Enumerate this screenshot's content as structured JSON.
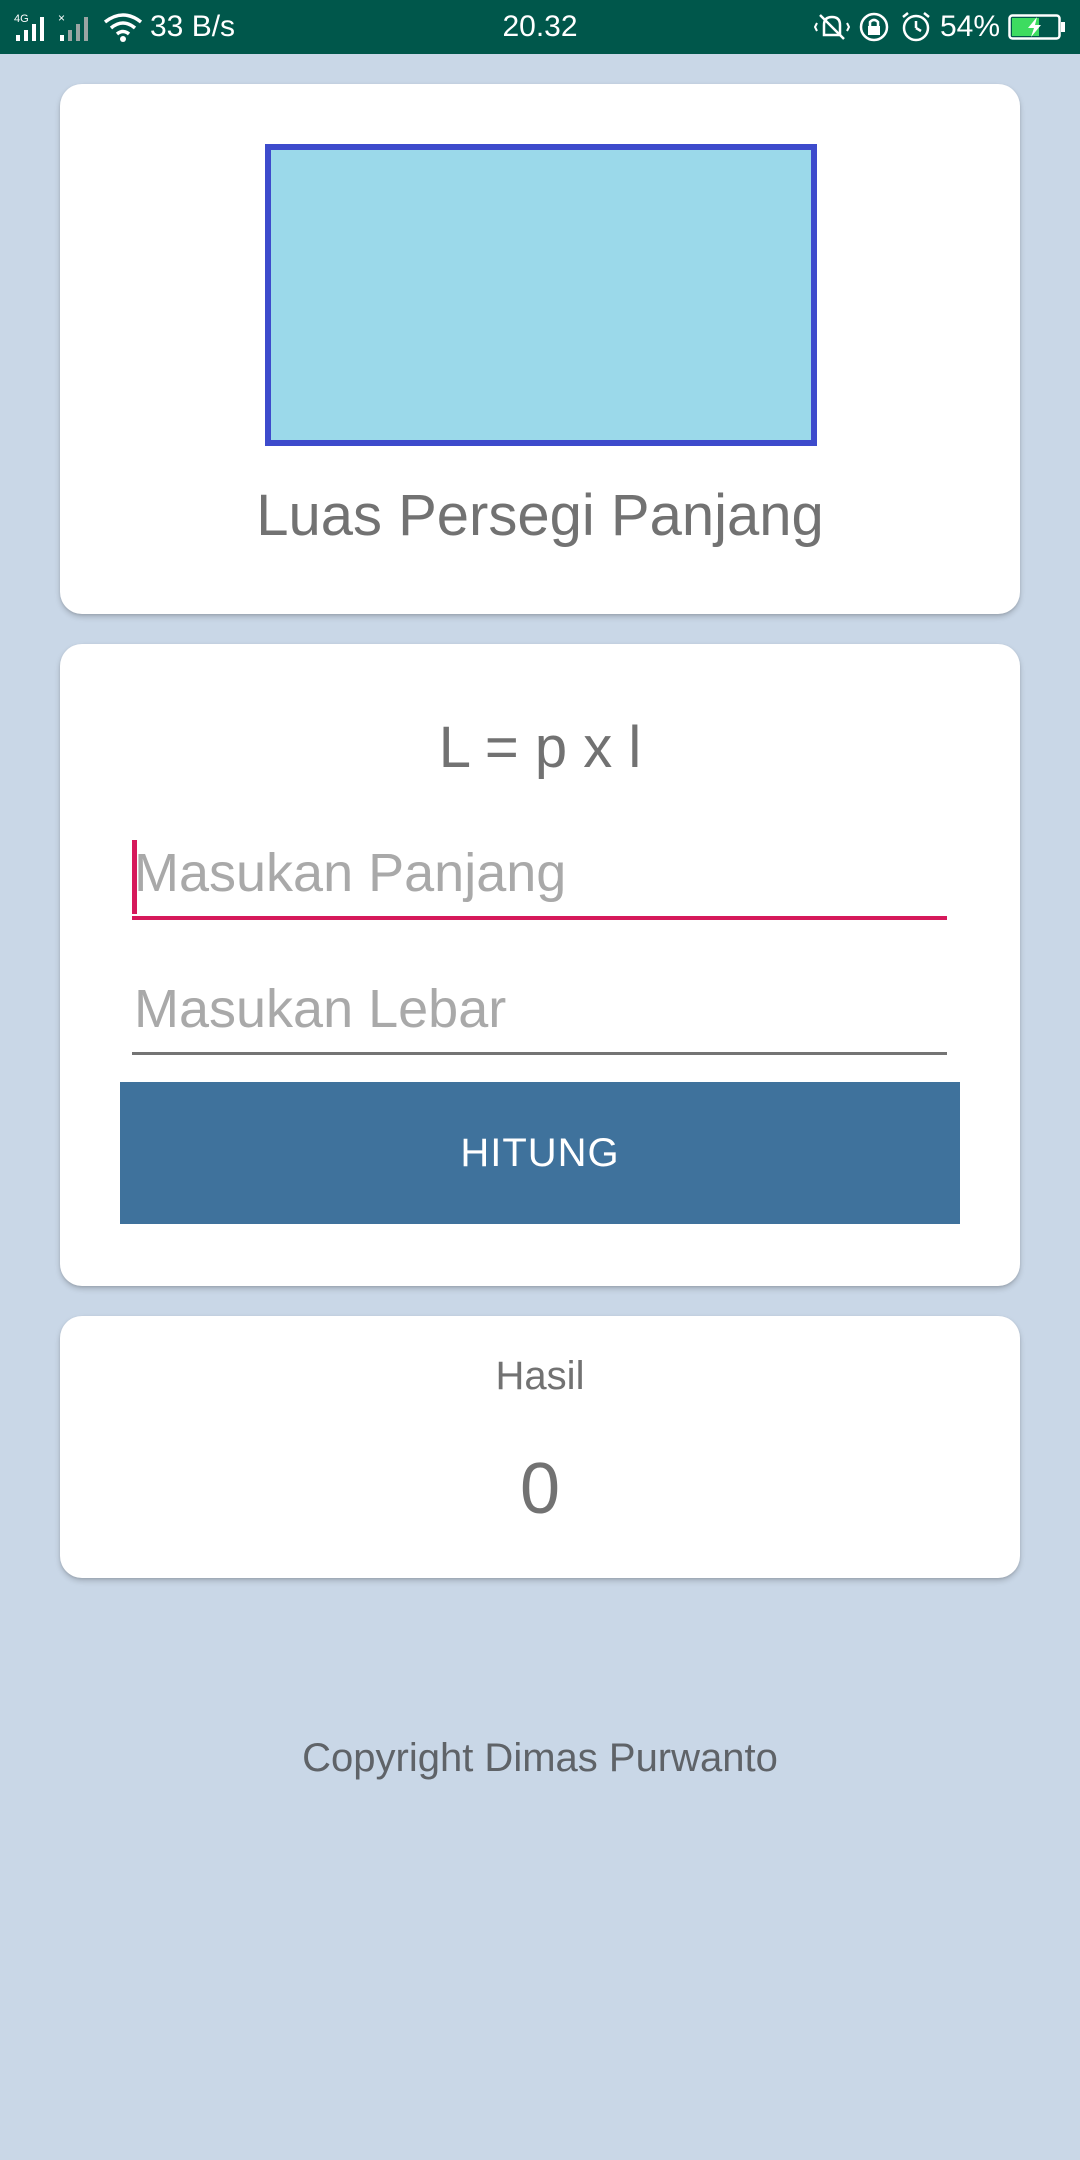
{
  "status_bar": {
    "network_type": "4G",
    "speed": "33 B/s",
    "time": "20.32",
    "battery": "54%",
    "icons": [
      "signal-icon",
      "no-signal-icon",
      "wifi-icon",
      "vibrate-icon",
      "rotation-lock-icon",
      "alarm-icon",
      "battery-charging-icon"
    ]
  },
  "shape_card": {
    "title": "Luas Persegi Panjang",
    "rect_fill": "#9bd9ea",
    "rect_border": "#3d4bcc"
  },
  "form_card": {
    "formula": "L = p x l",
    "panjang_placeholder": "Masukan Panjang",
    "panjang_value": "",
    "lebar_placeholder": "Masukan Lebar",
    "lebar_value": "",
    "button_label": "HITUNG",
    "button_color": "#3f729c",
    "focus_color": "#d6195b"
  },
  "result_card": {
    "label": "Hasil",
    "value": "0"
  },
  "footer": {
    "copyright": "Copyright Dimas Purwanto"
  },
  "colors": {
    "background": "#c9d7e7",
    "status_bar": "#00574b",
    "text_gray": "#727272"
  }
}
